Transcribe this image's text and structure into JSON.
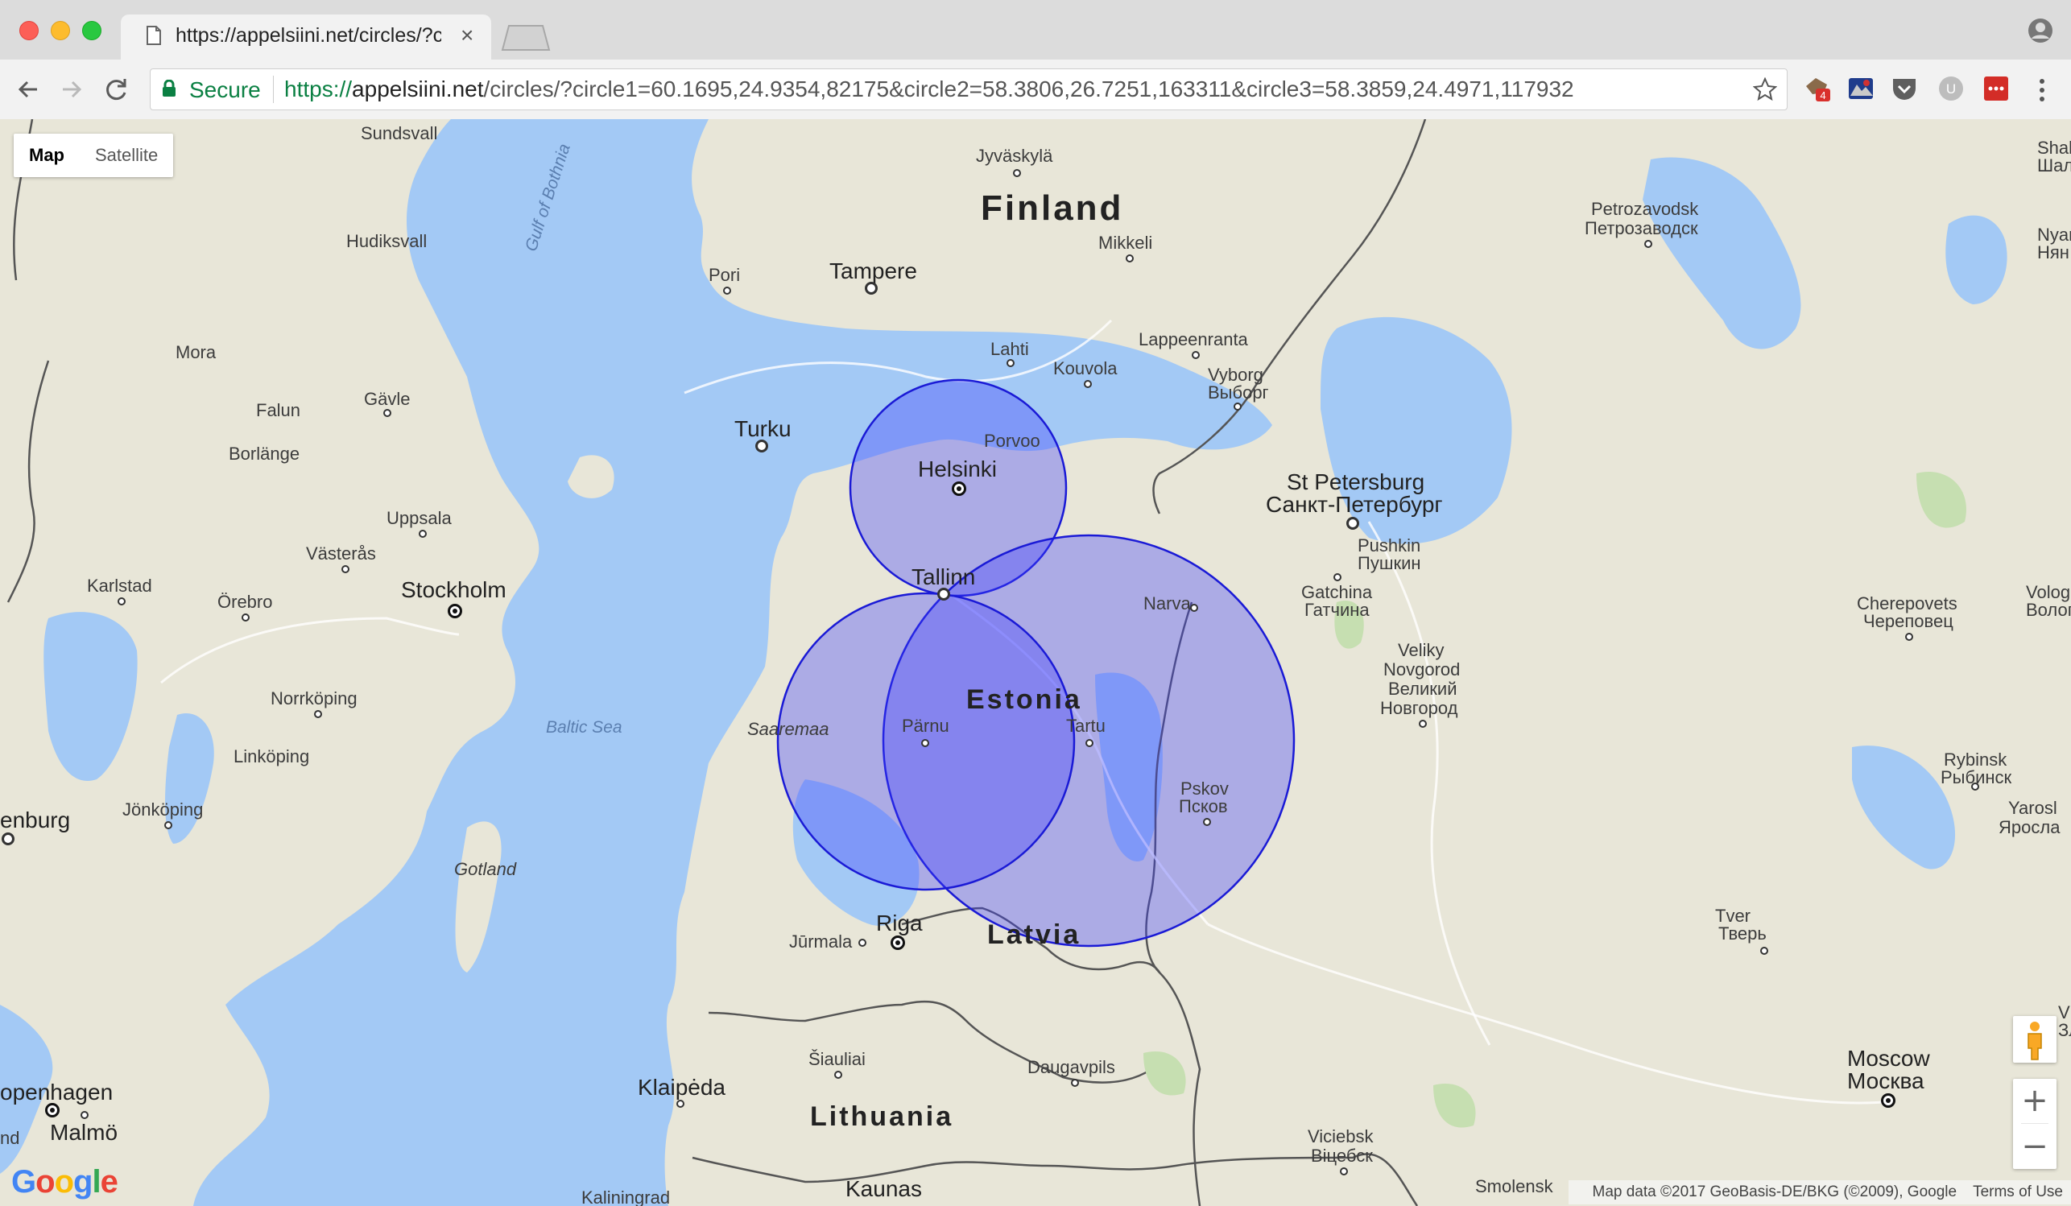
{
  "browser": {
    "tab_title": "https://appelsiini.net/circles/?c",
    "tab_close": "×",
    "secure_label": "Secure",
    "url_scheme": "https://",
    "url_host": "appelsiini.net",
    "url_path": "/circles/?circle1=60.1695,24.9354,82175&circle2=58.3806,26.7251,163311&circle3=58.3859,24.4971,117932",
    "extension_badge": "4",
    "colors": {
      "secure": "#0b8043",
      "tab_bg": "#f2f2f2",
      "chrome_bg": "#dcdcdc"
    }
  },
  "map": {
    "map_type": {
      "map": "Map",
      "satellite": "Satellite",
      "selected": "Map"
    },
    "zoom": {
      "in": "+",
      "out": "−"
    },
    "logo": "Google",
    "attribution": {
      "data": "Map data ©2017 GeoBasis-DE/BKG (©2009), Google",
      "terms": "Terms of Use"
    },
    "circle_color": "#3c3cff",
    "countries": {
      "finland": "Finland",
      "estonia": "Estonia",
      "latvia": "Latvia",
      "lithuania": "Lithuania"
    },
    "water": {
      "gulf": "Gulf of Bothnia",
      "baltic": "Baltic Sea",
      "saaremaa": "Saaremaa",
      "gotland": "Gotland"
    },
    "cities": {
      "sundsvall": "Sundsvall",
      "jyvaskyla": "Jyväskylä",
      "hudiksvall": "Hudiksvall",
      "mikkeli": "Mikkeli",
      "pori": "Pori",
      "tampere": "Tampere",
      "petrozavodsk": "Petrozavodsk",
      "petrozavodsk_ru": "Петрозаводск",
      "lahti": "Lahti",
      "kouvola": "Kouvola",
      "lappeenranta": "Lappeenranta",
      "vyborg": "Vyborg",
      "vyborg_ru": "Выборг",
      "mora": "Mora",
      "gavle": "Gävle",
      "falun": "Falun",
      "borlange": "Borlänge",
      "turku": "Turku",
      "porvoo": "Porvoo",
      "helsinki": "Helsinki",
      "uppsala": "Uppsala",
      "vasteras": "Västerås",
      "stockholm": "Stockholm",
      "karlstad": "Karlstad",
      "orebro": "Örebro",
      "tallinn": "Tallinn",
      "narva": "Narva",
      "stpetersburg": "St Petersburg",
      "stpetersburg_ru": "Санкт-Петербург",
      "pushkin": "Pushkin",
      "pushkin_ru": "Пушкин",
      "gatchina": "Gatchina",
      "gatchina_ru": "Гатчина",
      "cherepovets": "Cherepovets",
      "cherepovets_ru": "Череповец",
      "vologda": "Volog",
      "vologda_ru": "Волог",
      "veliky": "Veliky",
      "novgorod": "Novgorod",
      "veliky_ru": "Великий",
      "novgorod_ru": "Новгород",
      "norrkoping": "Norrköping",
      "linkoping": "Linköping",
      "parnu": "Pärnu",
      "tartu": "Tartu",
      "pskov": "Pskov",
      "pskov_ru": "Псков",
      "rybinsk": "Rybinsk",
      "rybinsk_ru": "Рыбинск",
      "yarosl": "Yarosl",
      "yarosl_ru": "Яросла",
      "enburg": "enburg",
      "jonkoping": "Jönköping",
      "riga": "Riga",
      "jurmala": "Jūrmala",
      "tver": "Tver",
      "tver_ru": "Тверь",
      "siauliai": "Šiauliai",
      "daugavpils": "Daugavpils",
      "klaipeda": "Klaipėda",
      "moscow": "Moscow",
      "moscow_ru": "Москва",
      "copenhagen": "openhagen",
      "malmo": "Malmö",
      "viciebsk": "Viciebsk",
      "viciebsk_ru": "Віцебск",
      "kaunas": "Kaunas",
      "kaliningrad": "Kaliningrad",
      "smolensk": "Smolensk",
      "nd": "nd",
      "shal": "Shal",
      "shal_ru": "Шал",
      "nyar": "Nyar",
      "nyar_ru": "Нян",
      "v_edge": "V",
      "v_edge_ru": "Зл"
    }
  }
}
